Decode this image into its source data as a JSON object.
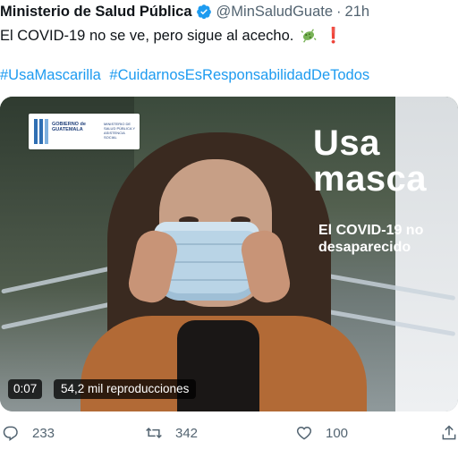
{
  "tweet": {
    "author_name": "Ministerio de Salud Pública",
    "handle": "@MinSaludGuate",
    "separator": "·",
    "time": "21h",
    "text": "El COVID-19 no se ve, pero sigue al acecho.",
    "emoji_icons": [
      "microbe-icon",
      "exclamation-icon"
    ],
    "exclamation": "❗",
    "hashtags": [
      "#UsaMascarilla",
      "#CuidarnosEsResponsabilidadDeTodos"
    ]
  },
  "media": {
    "logo_line1": "GOBIERNO de GUATEMALA",
    "logo_line2": "MINISTERIO DE SALUD PÚBLICA Y ASISTENCIA SOCIAL",
    "overlay_line1": "Usa",
    "overlay_line2": "masca",
    "overlay_line3": "El COVID-19 no",
    "overlay_line4": "desaparecido",
    "timestamp": "0:07",
    "views": "54,2 mil reproducciones"
  },
  "actions": {
    "replies": "233",
    "retweets": "342",
    "likes": "100"
  },
  "colors": {
    "link": "#1d9bf0",
    "verified": "#1d9bf0",
    "muted": "#536471"
  }
}
